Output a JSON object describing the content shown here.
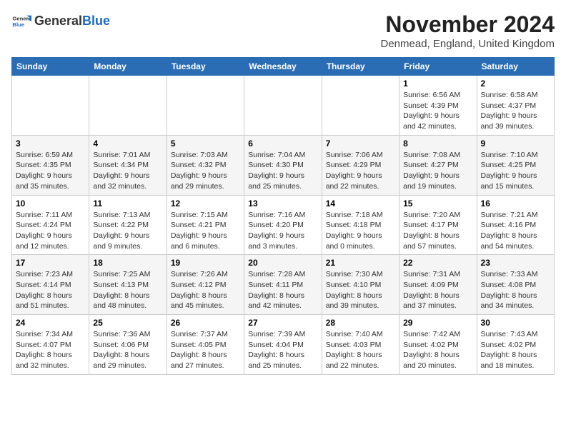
{
  "logo": {
    "general": "General",
    "blue": "Blue"
  },
  "header": {
    "month": "November 2024",
    "location": "Denmead, England, United Kingdom"
  },
  "days_of_week": [
    "Sunday",
    "Monday",
    "Tuesday",
    "Wednesday",
    "Thursday",
    "Friday",
    "Saturday"
  ],
  "weeks": [
    [
      {
        "day": "",
        "info": ""
      },
      {
        "day": "",
        "info": ""
      },
      {
        "day": "",
        "info": ""
      },
      {
        "day": "",
        "info": ""
      },
      {
        "day": "",
        "info": ""
      },
      {
        "day": "1",
        "info": "Sunrise: 6:56 AM\nSunset: 4:39 PM\nDaylight: 9 hours and 42 minutes."
      },
      {
        "day": "2",
        "info": "Sunrise: 6:58 AM\nSunset: 4:37 PM\nDaylight: 9 hours and 39 minutes."
      }
    ],
    [
      {
        "day": "3",
        "info": "Sunrise: 6:59 AM\nSunset: 4:35 PM\nDaylight: 9 hours and 35 minutes."
      },
      {
        "day": "4",
        "info": "Sunrise: 7:01 AM\nSunset: 4:34 PM\nDaylight: 9 hours and 32 minutes."
      },
      {
        "day": "5",
        "info": "Sunrise: 7:03 AM\nSunset: 4:32 PM\nDaylight: 9 hours and 29 minutes."
      },
      {
        "day": "6",
        "info": "Sunrise: 7:04 AM\nSunset: 4:30 PM\nDaylight: 9 hours and 25 minutes."
      },
      {
        "day": "7",
        "info": "Sunrise: 7:06 AM\nSunset: 4:29 PM\nDaylight: 9 hours and 22 minutes."
      },
      {
        "day": "8",
        "info": "Sunrise: 7:08 AM\nSunset: 4:27 PM\nDaylight: 9 hours and 19 minutes."
      },
      {
        "day": "9",
        "info": "Sunrise: 7:10 AM\nSunset: 4:25 PM\nDaylight: 9 hours and 15 minutes."
      }
    ],
    [
      {
        "day": "10",
        "info": "Sunrise: 7:11 AM\nSunset: 4:24 PM\nDaylight: 9 hours and 12 minutes."
      },
      {
        "day": "11",
        "info": "Sunrise: 7:13 AM\nSunset: 4:22 PM\nDaylight: 9 hours and 9 minutes."
      },
      {
        "day": "12",
        "info": "Sunrise: 7:15 AM\nSunset: 4:21 PM\nDaylight: 9 hours and 6 minutes."
      },
      {
        "day": "13",
        "info": "Sunrise: 7:16 AM\nSunset: 4:20 PM\nDaylight: 9 hours and 3 minutes."
      },
      {
        "day": "14",
        "info": "Sunrise: 7:18 AM\nSunset: 4:18 PM\nDaylight: 9 hours and 0 minutes."
      },
      {
        "day": "15",
        "info": "Sunrise: 7:20 AM\nSunset: 4:17 PM\nDaylight: 8 hours and 57 minutes."
      },
      {
        "day": "16",
        "info": "Sunrise: 7:21 AM\nSunset: 4:16 PM\nDaylight: 8 hours and 54 minutes."
      }
    ],
    [
      {
        "day": "17",
        "info": "Sunrise: 7:23 AM\nSunset: 4:14 PM\nDaylight: 8 hours and 51 minutes."
      },
      {
        "day": "18",
        "info": "Sunrise: 7:25 AM\nSunset: 4:13 PM\nDaylight: 8 hours and 48 minutes."
      },
      {
        "day": "19",
        "info": "Sunrise: 7:26 AM\nSunset: 4:12 PM\nDaylight: 8 hours and 45 minutes."
      },
      {
        "day": "20",
        "info": "Sunrise: 7:28 AM\nSunset: 4:11 PM\nDaylight: 8 hours and 42 minutes."
      },
      {
        "day": "21",
        "info": "Sunrise: 7:30 AM\nSunset: 4:10 PM\nDaylight: 8 hours and 39 minutes."
      },
      {
        "day": "22",
        "info": "Sunrise: 7:31 AM\nSunset: 4:09 PM\nDaylight: 8 hours and 37 minutes."
      },
      {
        "day": "23",
        "info": "Sunrise: 7:33 AM\nSunset: 4:08 PM\nDaylight: 8 hours and 34 minutes."
      }
    ],
    [
      {
        "day": "24",
        "info": "Sunrise: 7:34 AM\nSunset: 4:07 PM\nDaylight: 8 hours and 32 minutes."
      },
      {
        "day": "25",
        "info": "Sunrise: 7:36 AM\nSunset: 4:06 PM\nDaylight: 8 hours and 29 minutes."
      },
      {
        "day": "26",
        "info": "Sunrise: 7:37 AM\nSunset: 4:05 PM\nDaylight: 8 hours and 27 minutes."
      },
      {
        "day": "27",
        "info": "Sunrise: 7:39 AM\nSunset: 4:04 PM\nDaylight: 8 hours and 25 minutes."
      },
      {
        "day": "28",
        "info": "Sunrise: 7:40 AM\nSunset: 4:03 PM\nDaylight: 8 hours and 22 minutes."
      },
      {
        "day": "29",
        "info": "Sunrise: 7:42 AM\nSunset: 4:02 PM\nDaylight: 8 hours and 20 minutes."
      },
      {
        "day": "30",
        "info": "Sunrise: 7:43 AM\nSunset: 4:02 PM\nDaylight: 8 hours and 18 minutes."
      }
    ]
  ]
}
